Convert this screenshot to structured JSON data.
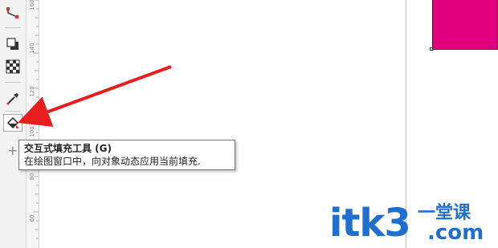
{
  "toolbox": {
    "tools": [
      {
        "name": "connector-tool",
        "icon": "connector-icon"
      },
      {
        "name": "drop-shadow-tool",
        "icon": "drop-shadow-icon"
      },
      {
        "name": "transparency-tool",
        "icon": "transparency-icon"
      },
      {
        "name": "eyedropper-tool",
        "icon": "eyedropper-icon"
      },
      {
        "name": "interactive-fill-tool",
        "icon": "interactive-fill-icon",
        "active": true
      }
    ],
    "add_icon": "+"
  },
  "ruler": {
    "labels": [
      "160",
      "140",
      "120",
      "100",
      "80",
      "60"
    ]
  },
  "tooltip": {
    "title": "交互式填充工具 (G)",
    "description": "在绘图窗口中，向对象动态应用当前填充."
  },
  "canvas": {
    "shape_color": "#e3007f",
    "arrow_color": "#e61e1e"
  },
  "watermark": {
    "main": "itk3",
    "sub": "一堂课",
    "com": ".com"
  }
}
